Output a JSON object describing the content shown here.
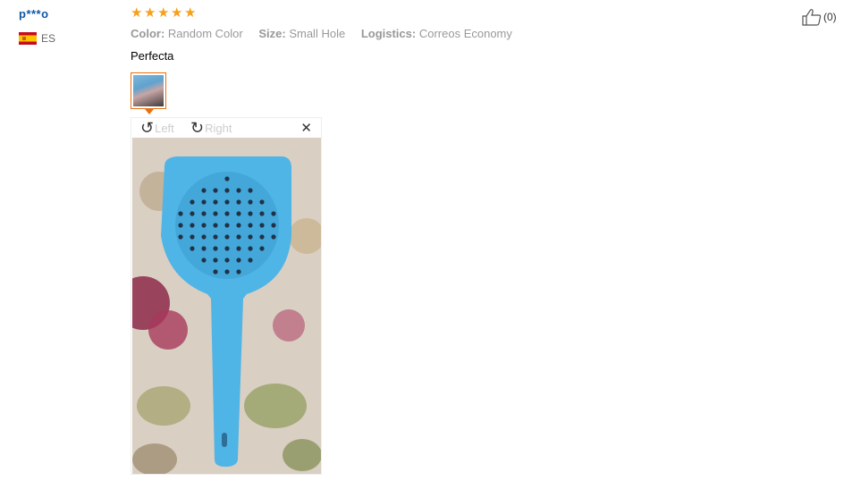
{
  "user": {
    "name": "p***o",
    "country_code": "ES",
    "flag_icon": "spain-flag-icon"
  },
  "review": {
    "rating": 5,
    "rating_max": 5,
    "attributes": [
      {
        "key": "Color:",
        "value": "Random Color"
      },
      {
        "key": "Size:",
        "value": "Small Hole"
      },
      {
        "key": "Logistics:",
        "value": "Correos Economy"
      }
    ],
    "text": "Perfecta"
  },
  "viewer": {
    "rotate_left_label": "Left",
    "rotate_right_label": "Right",
    "close_glyph": "✕",
    "photo_subject": "blue plastic slotted scoop on floral fabric"
  },
  "like": {
    "count_label": "(0)"
  },
  "colors": {
    "accent": "#e8700f",
    "star": "#f7a11a",
    "username": "#0e57a6",
    "scoop": "#4fb4e6"
  }
}
